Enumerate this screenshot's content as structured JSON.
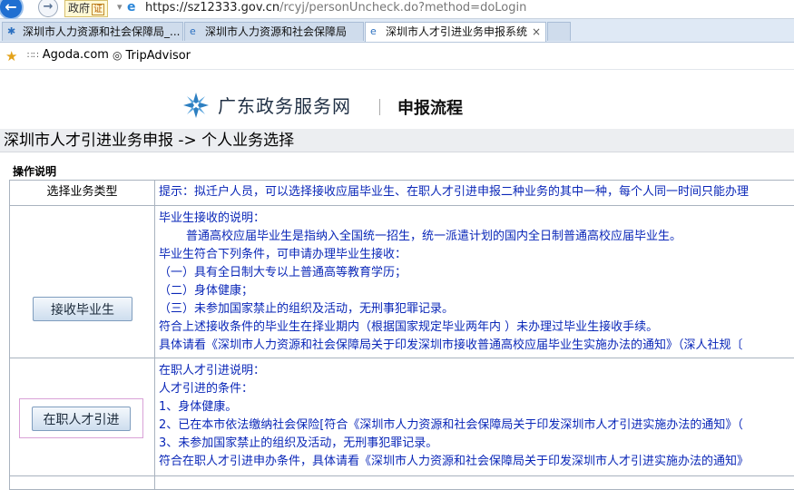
{
  "browser": {
    "gov_badge": "政府",
    "gov_seal": "证",
    "url_main": "https://sz12333.gov.cn",
    "url_path": "/rcyj/personUncheck.do?method=doLogin",
    "tabs": [
      {
        "label": "深圳市人力资源和社会保障局_..."
      },
      {
        "label": "深圳市人力资源和社会保障局"
      },
      {
        "label": "深圳市人才引进业务申报系统"
      }
    ],
    "favorites": [
      {
        "label": "Agoda.com"
      },
      {
        "label": "TripAdvisor"
      }
    ]
  },
  "header": {
    "site_name": "广东政务服务网",
    "flow_title": "申报流程"
  },
  "page": {
    "title": "深圳市人才引进业务申报 -> 个人业务选择",
    "section_label": "操作说明",
    "type_header": "选择业务类型",
    "hint": "提示：拟迁户人员，可以选择接收应届毕业生、在职人才引进申报二种业务的其中一种，每个人同一时间只能办理"
  },
  "graduate": {
    "button": "接收毕业生",
    "lines": [
      "毕业生接收的说明：",
      "普通高校应届毕业生是指纳入全国统一招生，统一派遣计划的国内全日制普通高校应届毕业生。",
      "毕业生符合下列条件，可申请办理毕业生接收：",
      "（一）具有全日制大专以上普通高等教育学历；",
      "（二）身体健康；",
      "（三）未参加国家禁止的组织及活动，无刑事犯罪记录。",
      "符合上述接收条件的毕业生在择业期内（根据国家规定毕业两年内 ）未办理过毕业生接收手续。",
      "具体请看《深圳市人力资源和社会保障局关于印发深圳市接收普通高校应届毕业生实施办法的通知》（深人社规〔"
    ]
  },
  "talent": {
    "button": "在职人才引进",
    "lines": [
      "在职人才引进说明：",
      "人才引进的条件：",
      "1、身体健康。",
      "2、已在本市依法缴纳社会保险[符合《深圳市人力资源和社会保障局关于印发深圳市人才引进实施办法的通知》（",
      "3、未参加国家禁止的组织及活动，无刑事犯罪记录。",
      "符合在职人才引进申办条件，具体请看《深圳市人力资源和社会保障局关于印发深圳市人才引进实施办法的通知》"
    ]
  }
}
